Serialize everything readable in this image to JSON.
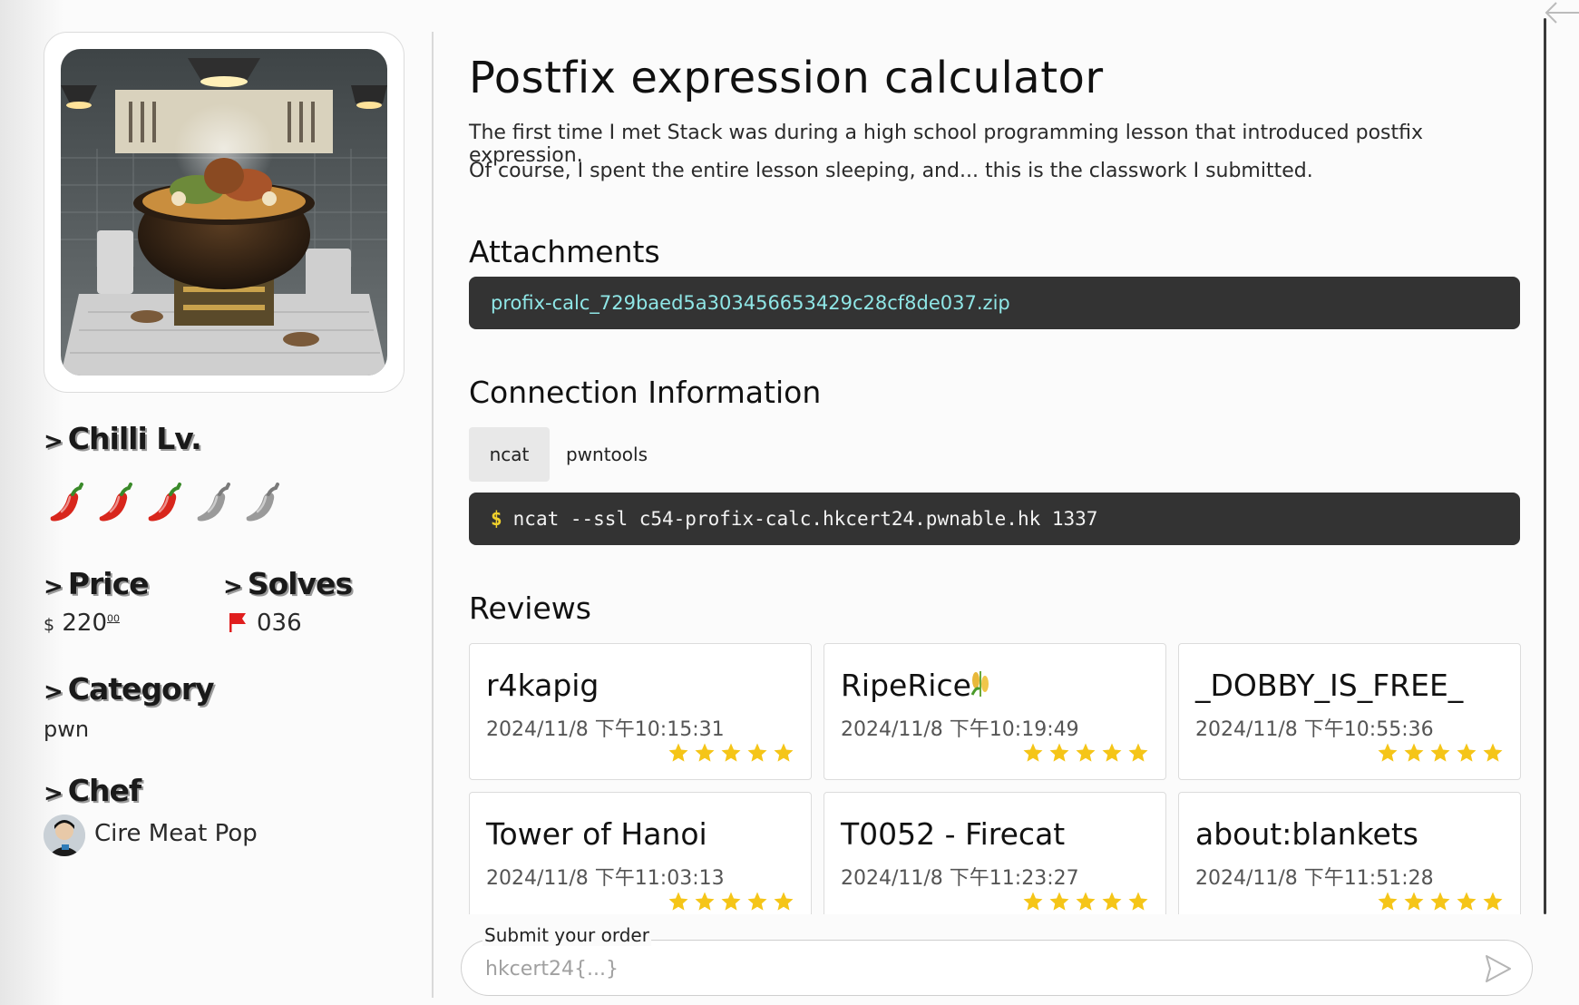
{
  "sidebar": {
    "chilli_heading": "Chilli Lv.",
    "chilli_level": 3,
    "chilli_max": 5,
    "price_heading": "Price",
    "price_currency": "$",
    "price_value": "220",
    "price_cents": "00",
    "solves_heading": "Solves",
    "solves_value": "036",
    "category_heading": "Category",
    "category_value": "pwn",
    "chef_heading": "Chef",
    "chef_name": "Cire Meat Pop",
    "arrow_glyph": ">"
  },
  "challenge": {
    "title": "Postfix expression calculator",
    "description_line1": "The first time I met Stack was during a high school programming lesson that introduced postfix expression.",
    "description_line2": "Of course, I spent the entire lesson sleeping, and... this is the classwork I submitted."
  },
  "attachments": {
    "heading": "Attachments",
    "file": "profix-calc_729baed5a303456653429c28cf8de037.zip"
  },
  "connection": {
    "heading": "Connection Information",
    "tabs": [
      "ncat",
      "pwntools"
    ],
    "active_tab": "ncat",
    "prompt": "$",
    "command": "ncat --ssl c54-profix-calc.hkcert24.pwnable.hk 1337"
  },
  "reviews": {
    "heading": "Reviews",
    "items": [
      {
        "name": "r4kapig",
        "date": "2024/11/8 下午10:15:31",
        "stars": 5
      },
      {
        "name": "RipeRice",
        "date": "2024/11/8 下午10:19:49",
        "stars": 5,
        "badge": "rice-plant-icon"
      },
      {
        "name": "_DOBBY_IS_FREE_",
        "date": "2024/11/8 下午10:55:36",
        "stars": 5
      },
      {
        "name": "Tower of Hanoi",
        "date": "2024/11/8 下午11:03:13",
        "stars": 5
      },
      {
        "name": "T0052 - Firecat",
        "date": "2024/11/8 下午11:23:27",
        "stars": 5
      },
      {
        "name": "about:blankets",
        "date": "2024/11/8 下午11:51:28",
        "stars": 5
      }
    ]
  },
  "order": {
    "label": "Submit your order",
    "placeholder": "hkcert24{...}",
    "value": ""
  },
  "colors": {
    "pepper_active": "#d8261c",
    "pepper_inactive": "#9a9a9a",
    "star": "#f5c518",
    "code_bg": "#333333",
    "link": "#8fe6e6",
    "prompt": "#f2d22c",
    "flag": "#e01e1e"
  }
}
